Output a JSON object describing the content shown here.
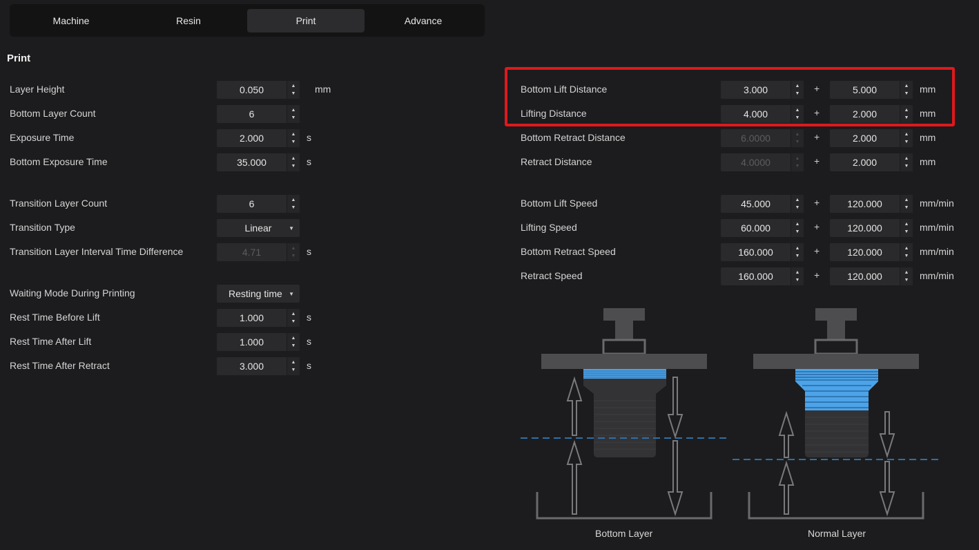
{
  "tabs": [
    {
      "label": "Machine",
      "active": false
    },
    {
      "label": "Resin",
      "active": false
    },
    {
      "label": "Print",
      "active": true
    },
    {
      "label": "Advance",
      "active": false
    }
  ],
  "section_title": "Print",
  "left": {
    "layer_height": {
      "label": "Layer Height",
      "value": "0.050",
      "unit": "mm"
    },
    "bottom_layer_count": {
      "label": "Bottom Layer Count",
      "value": "6"
    },
    "exposure_time": {
      "label": "Exposure Time",
      "value": "2.000",
      "unit": "s"
    },
    "bottom_exposure_time": {
      "label": "Bottom Exposure Time",
      "value": "35.000",
      "unit": "s"
    },
    "transition_layer_count": {
      "label": "Transition Layer Count",
      "value": "6"
    },
    "transition_type": {
      "label": "Transition Type",
      "value": "Linear"
    },
    "transition_interval": {
      "label": "Transition Layer Interval Time Difference",
      "value": "4.71",
      "unit": "s"
    },
    "waiting_mode": {
      "label": "Waiting Mode During Printing",
      "value": "Resting time"
    },
    "rest_before_lift": {
      "label": "Rest Time Before Lift",
      "value": "1.000",
      "unit": "s"
    },
    "rest_after_lift": {
      "label": "Rest Time After Lift",
      "value": "1.000",
      "unit": "s"
    },
    "rest_after_retract": {
      "label": "Rest Time After Retract",
      "value": "3.000",
      "unit": "s"
    }
  },
  "right": {
    "bottom_lift_distance": {
      "label": "Bottom Lift Distance",
      "value1": "3.000",
      "value2": "5.000",
      "unit": "mm"
    },
    "lifting_distance": {
      "label": "Lifting Distance",
      "value1": "4.000",
      "value2": "2.000",
      "unit": "mm"
    },
    "bottom_retract_distance": {
      "label": "Bottom Retract Distance",
      "value1": "6.0000",
      "value2": "2.000",
      "unit": "mm"
    },
    "retract_distance": {
      "label": "Retract Distance",
      "value1": "4.0000",
      "value2": "2.000",
      "unit": "mm"
    },
    "bottom_lift_speed": {
      "label": "Bottom Lift Speed",
      "value1": "45.000",
      "value2": "120.000",
      "unit": "mm/min"
    },
    "lifting_speed": {
      "label": "Lifting Speed",
      "value1": "60.000",
      "value2": "120.000",
      "unit": "mm/min"
    },
    "bottom_retract_speed": {
      "label": "Bottom Retract Speed",
      "value1": "160.000",
      "value2": "120.000",
      "unit": "mm/min"
    },
    "retract_speed": {
      "label": "Retract Speed",
      "value1": "160.000",
      "value2": "120.000",
      "unit": "mm/min"
    }
  },
  "plus_sign": "+",
  "diagram": {
    "bottom_caption": "Bottom Layer",
    "normal_caption": "Normal Layer"
  },
  "colors": {
    "highlight": "#e0181c",
    "resin_blue": "#4da3e8",
    "dashed_line": "#2f6fa6"
  }
}
